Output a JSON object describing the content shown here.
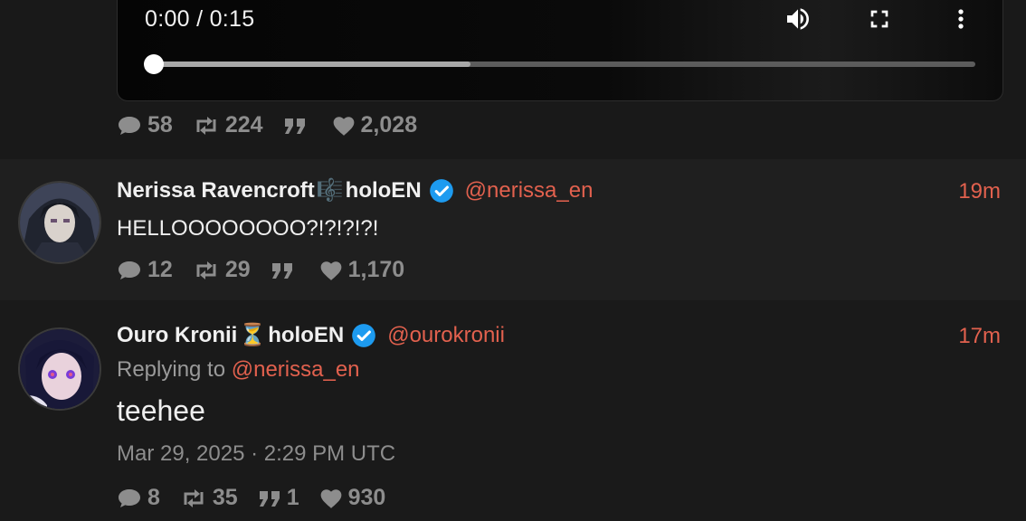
{
  "video": {
    "time_display": "0:00 / 0:15",
    "played_fraction": 0.0,
    "buffered_fraction": 0.385
  },
  "tweets": [
    {
      "stats": {
        "replies": "58",
        "retweets": "224",
        "quotes": "",
        "likes": "2,028"
      }
    },
    {
      "display_name": "Nerissa Ravencroft",
      "name_emoji": "🎼",
      "name_suffix": "holoEN",
      "handle": "@nerissa_en",
      "timestamp": "19m",
      "text": "HELLOOOOOOOO?!?!?!?!",
      "stats": {
        "replies": "12",
        "retweets": "29",
        "quotes": "",
        "likes": "1,170"
      }
    },
    {
      "display_name": "Ouro Kronii",
      "name_emoji": "⏳",
      "name_suffix": "holoEN",
      "handle": "@ourokronii",
      "timestamp": "17m",
      "replying_prefix": "Replying to",
      "replying_handle": "@nerissa_en",
      "text": "teehee",
      "date": "Mar 29, 2025 · 2:29 PM UTC",
      "stats": {
        "replies": "8",
        "retweets": "35",
        "quotes": "1",
        "likes": "930"
      }
    }
  ],
  "colors": {
    "accent": "#e2614e",
    "thread_line": "#9b3a36",
    "verified": "#1d9bf0",
    "muted": "#8d8d8d"
  },
  "icons": [
    "volume-icon",
    "fullscreen-icon",
    "more-vertical-icon",
    "comment-icon",
    "retweet-icon",
    "quote-icon",
    "heart-icon",
    "verified-badge-icon"
  ]
}
